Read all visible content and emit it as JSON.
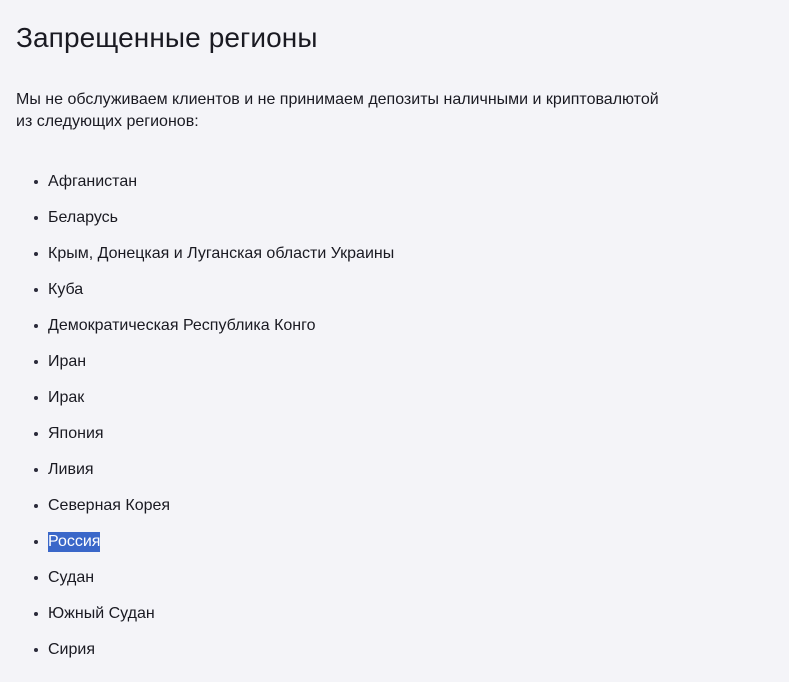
{
  "page": {
    "title": "Запрещенные регионы",
    "intro": "Мы не обслуживаем клиентов и не принимаем депозиты наличными и криптовалютой из следующих регионов:"
  },
  "regions": [
    {
      "label": "Афганистан",
      "selected": false
    },
    {
      "label": "Беларусь",
      "selected": false
    },
    {
      "label": "Крым, Донецкая и Луганская области Украины",
      "selected": false
    },
    {
      "label": "Куба",
      "selected": false
    },
    {
      "label": "Демократическая Республика Конго",
      "selected": false
    },
    {
      "label": "Иран",
      "selected": false
    },
    {
      "label": "Ирак",
      "selected": false
    },
    {
      "label": "Япония",
      "selected": false
    },
    {
      "label": "Ливия",
      "selected": false
    },
    {
      "label": "Северная Корея",
      "selected": false
    },
    {
      "label": "Россия",
      "selected": true
    },
    {
      "label": "Судан",
      "selected": false
    },
    {
      "label": "Южный Судан",
      "selected": false
    },
    {
      "label": "Сирия",
      "selected": false
    }
  ],
  "colors": {
    "background": "#f4f4f8",
    "text": "#1a1a22",
    "selection": "#3a67c9"
  }
}
